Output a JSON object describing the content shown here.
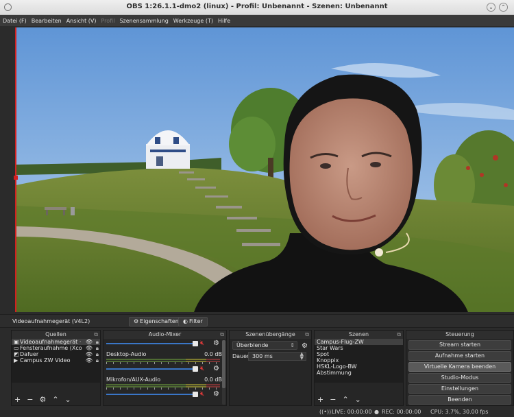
{
  "window": {
    "title": "OBS 1:26.1.1-dmo2 (linux) - Profil: Unbenannt - Szenen: Unbenannt"
  },
  "menu": [
    {
      "label": "Datei (F)",
      "disabled": false
    },
    {
      "label": "Bearbeiten",
      "disabled": false
    },
    {
      "label": "Ansicht (V)",
      "disabled": false
    },
    {
      "label": "Profil",
      "disabled": true
    },
    {
      "label": "Szenensammlung",
      "disabled": false
    },
    {
      "label": "Werkzeuge (T)",
      "disabled": false
    },
    {
      "label": "Hilfe",
      "disabled": false
    }
  ],
  "source_toolbar": {
    "source_name": "Videoaufnahmegerät (V4L2)",
    "properties_label": "Eigenschaften",
    "filter_label": "Filter"
  },
  "sources": {
    "title": "Quellen",
    "items": [
      {
        "label": "Videoaufnahmegerät ·",
        "icon": "camera-icon",
        "selected": true
      },
      {
        "label": "Fensteraufnahme (Xco",
        "icon": "window-icon",
        "selected": false
      },
      {
        "label": "Dafuer",
        "icon": "image-icon",
        "selected": false
      },
      {
        "label": "Campus ZW Video",
        "icon": "play-icon",
        "selected": false
      }
    ]
  },
  "mixer": {
    "title": "Audio-Mixer",
    "channels": [
      {
        "name": "Desktop-Audio",
        "db": "0.0 dB"
      },
      {
        "name": "Mikrofon/AUX-Audio",
        "db": "0.0 dB"
      }
    ]
  },
  "transitions": {
    "title": "Szenenübergänge",
    "selected": "Überblende",
    "duration_label": "Dauer",
    "duration_value": "300 ms"
  },
  "scenes": {
    "title": "Szenen",
    "items": [
      "Campus-Flug-ZW",
      "Star Wars",
      "Spot",
      "Knoppix",
      "HSKL-Logo-BW",
      "Abstimmung"
    ],
    "selected_index": 0
  },
  "controls": {
    "title": "Steuerung",
    "buttons": [
      {
        "label": "Stream starten",
        "active": false
      },
      {
        "label": "Aufnahme starten",
        "active": false
      },
      {
        "label": "Virtuelle Kamera beenden",
        "active": true
      },
      {
        "label": "Studio-Modus",
        "active": false
      },
      {
        "label": "Einstellungen",
        "active": false
      },
      {
        "label": "Beenden",
        "active": false
      }
    ]
  },
  "status": {
    "live": "LIVE: 00:00:00",
    "rec": "REC: 00:00:00",
    "cpu": "CPU: 3.7%, 30.00 fps"
  },
  "colors": {
    "accent": "#3a76c7",
    "selection": "#d42020",
    "mute": "#e23a3a"
  }
}
